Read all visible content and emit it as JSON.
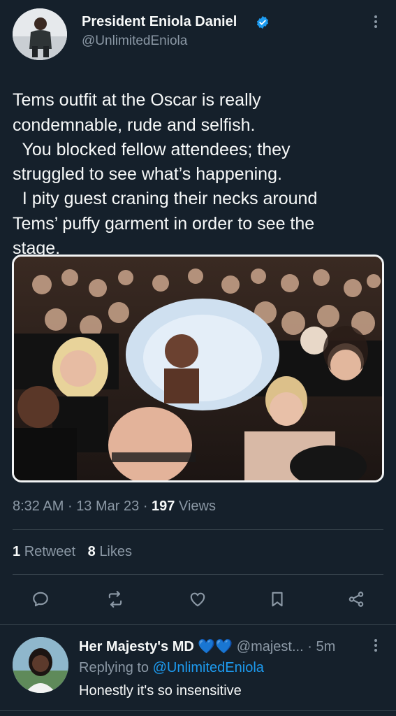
{
  "tweet": {
    "author_name": "President Eniola Daniel",
    "author_handle": "@UnlimitedEniola",
    "text_lines": [
      "Tems outfit at the Oscar is really",
      "condemnable, rude and selfish.",
      "  You blocked fellow attendees; they",
      "struggled to see what’s happening.",
      "  I pity guest craning their necks around",
      "Tems’ puffy garment in order to see the",
      "stage."
    ],
    "time": "8:32 AM",
    "date": "13 Mar 23",
    "views_count": "197",
    "views_label": "Views",
    "retweets_count": "1",
    "retweets_label": "Retweet",
    "likes_count": "8",
    "likes_label": "Likes",
    "sep": "·"
  },
  "reply": {
    "author_name": "Her Majesty's MD",
    "author_emoji": "💙💙",
    "author_handle": "@majest...",
    "age": "5m",
    "replying_prefix": "Replying to",
    "replying_to": "@UnlimitedEniola",
    "text": "Honestly it's so insensitive"
  },
  "icons": {
    "verified": "verified-badge-icon",
    "more": "more-vertical-icon",
    "reply": "reply-bubble-icon",
    "retweet": "retweet-icon",
    "like": "heart-icon",
    "bookmark": "bookmark-icon",
    "share": "share-icon"
  },
  "colors": {
    "background": "#15202b",
    "accent": "#1d9bf0",
    "muted": "#8b98a5",
    "divider": "#38444d"
  }
}
